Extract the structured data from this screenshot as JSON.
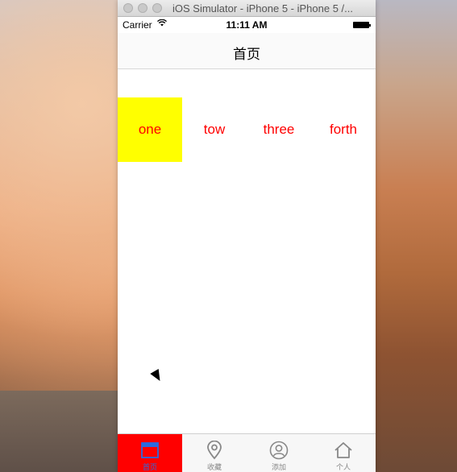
{
  "window": {
    "title": "iOS Simulator - iPhone 5 - iPhone 5 /..."
  },
  "status_bar": {
    "carrier": "Carrier",
    "time": "11:11 AM"
  },
  "nav": {
    "title": "首页"
  },
  "segments": [
    {
      "label": "one",
      "selected": true
    },
    {
      "label": "tow",
      "selected": false
    },
    {
      "label": "three",
      "selected": false
    },
    {
      "label": "forth",
      "selected": false
    }
  ],
  "tabbar": {
    "items": [
      {
        "label": "首页",
        "icon": "home-square-icon",
        "active": true
      },
      {
        "label": "收藏",
        "icon": "map-pin-icon",
        "active": false
      },
      {
        "label": "添加",
        "icon": "person-circle-icon",
        "active": false
      },
      {
        "label": "个人",
        "icon": "house-icon",
        "active": false
      }
    ]
  },
  "colors": {
    "segment_text": "#ff0000",
    "segment_selected_bg": "#ffff00",
    "tab_active_bg": "#ff0000",
    "tab_active_label": "#2a6be0"
  }
}
